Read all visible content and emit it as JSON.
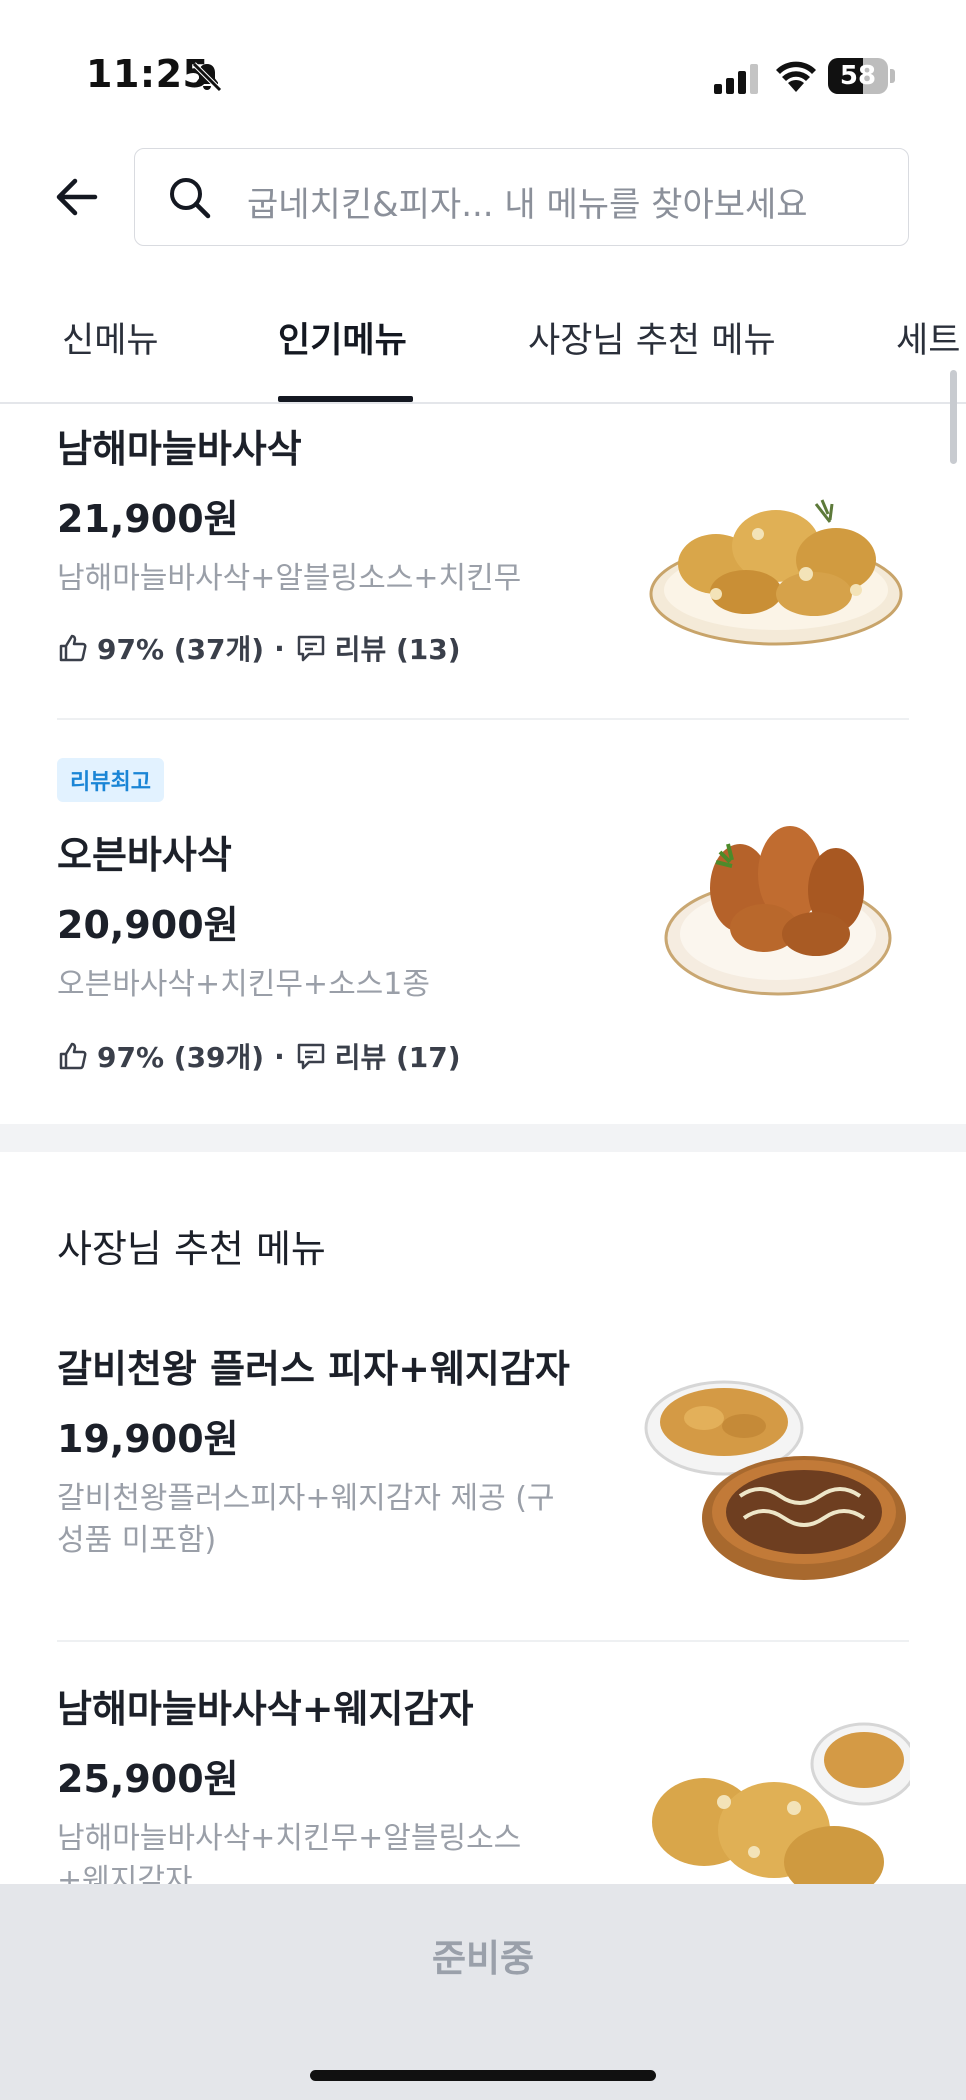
{
  "status_bar": {
    "time": "11:25",
    "battery_level": "58",
    "battery_fraction": 0.58
  },
  "search": {
    "placeholder": "굽네치킨&피자...  내 메뉴를 찾아보세요"
  },
  "tabs": [
    {
      "label": "신메뉴",
      "active": false
    },
    {
      "label": "인기메뉴",
      "active": true
    },
    {
      "label": "사장님 추천 메뉴",
      "active": false
    },
    {
      "label": "세트",
      "active": false
    }
  ],
  "popular_items": [
    {
      "name": "남해마늘바사삭",
      "price": "21,900원",
      "description": "남해마늘바사삭+알블링소스+치킨무",
      "rating": "97% (37개)",
      "reviews": "리뷰 (13)"
    },
    {
      "badge": "리뷰최고",
      "name": "오븐바사삭",
      "price": "20,900원",
      "description": "오븐바사삭+치킨무+소스1종",
      "rating": "97% (39개)",
      "reviews": "리뷰 (17)"
    }
  ],
  "recommended_section": {
    "title": "사장님 추천 메뉴",
    "items": [
      {
        "name": "갈비천왕 플러스 피자+웨지감자",
        "price": "19,900원",
        "description": "갈비천왕플러스피자+웨지감자 제공 (구성품 미포함)"
      },
      {
        "name": "남해마늘바사삭+웨지감자",
        "price": "25,900원",
        "description": "남해마늘바사삭+치킨무+알블링소스 +웨지감자"
      }
    ]
  },
  "bottom_bar": {
    "label": "준비중"
  },
  "colors": {
    "badge_text": "#1a85d6",
    "badge_bg": "#e2f2ff",
    "active_tab": "#141821",
    "bottom_bar": "#e4e6ea"
  }
}
